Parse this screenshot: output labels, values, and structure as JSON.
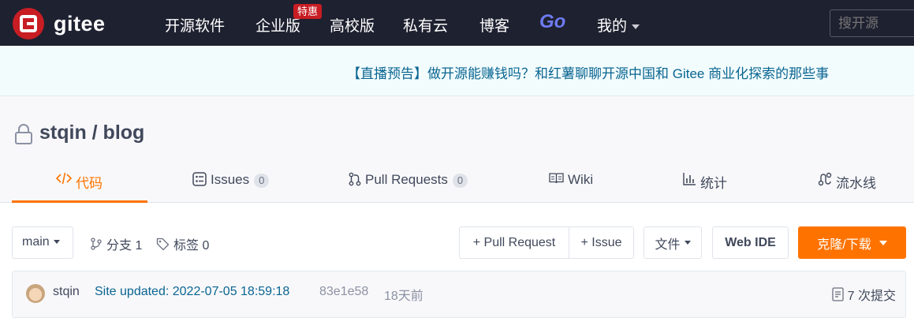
{
  "nav": {
    "brand": "gitee",
    "items": [
      "开源软件",
      "企业版",
      "高校版",
      "私有云",
      "博客"
    ],
    "hot_badge": "特惠",
    "go_label": "Go",
    "mine": "我的",
    "search_placeholder": "搜开源"
  },
  "announcement": "【直播预告】做开源能赚钱吗？和红薯聊聊开源中国和 Gitee 商业化探索的那些事",
  "repo": {
    "title": "stqin / blog",
    "tabs": [
      {
        "label": "代码",
        "icon": "code-icon",
        "active": true
      },
      {
        "label": "Issues",
        "count": "0",
        "icon": "issues-icon"
      },
      {
        "label": "Pull Requests",
        "count": "0",
        "icon": "pull-request-icon"
      },
      {
        "label": "Wiki",
        "icon": "wiki-icon"
      },
      {
        "label": "统计",
        "icon": "stats-icon"
      },
      {
        "label": "流水线",
        "icon": "pipeline-icon"
      }
    ]
  },
  "toolbar": {
    "branch": "main",
    "branches": "分支 1",
    "tags": "标签 0",
    "pull_request_btn": "+ Pull Request",
    "issue_btn": "+ Issue",
    "file_btn": "文件",
    "webide_btn": "Web IDE",
    "clone_btn": "克隆/下载"
  },
  "commit": {
    "author": "stqin",
    "message": "Site updated: 2022-07-05 18:59:18",
    "hash": "83e1e58",
    "time": "18天前",
    "count": "7 次提交"
  },
  "colors": {
    "nav_bg": "#1e2130",
    "accent": "#fe7300",
    "brand_red": "#c71d23",
    "link": "#0a6591"
  }
}
